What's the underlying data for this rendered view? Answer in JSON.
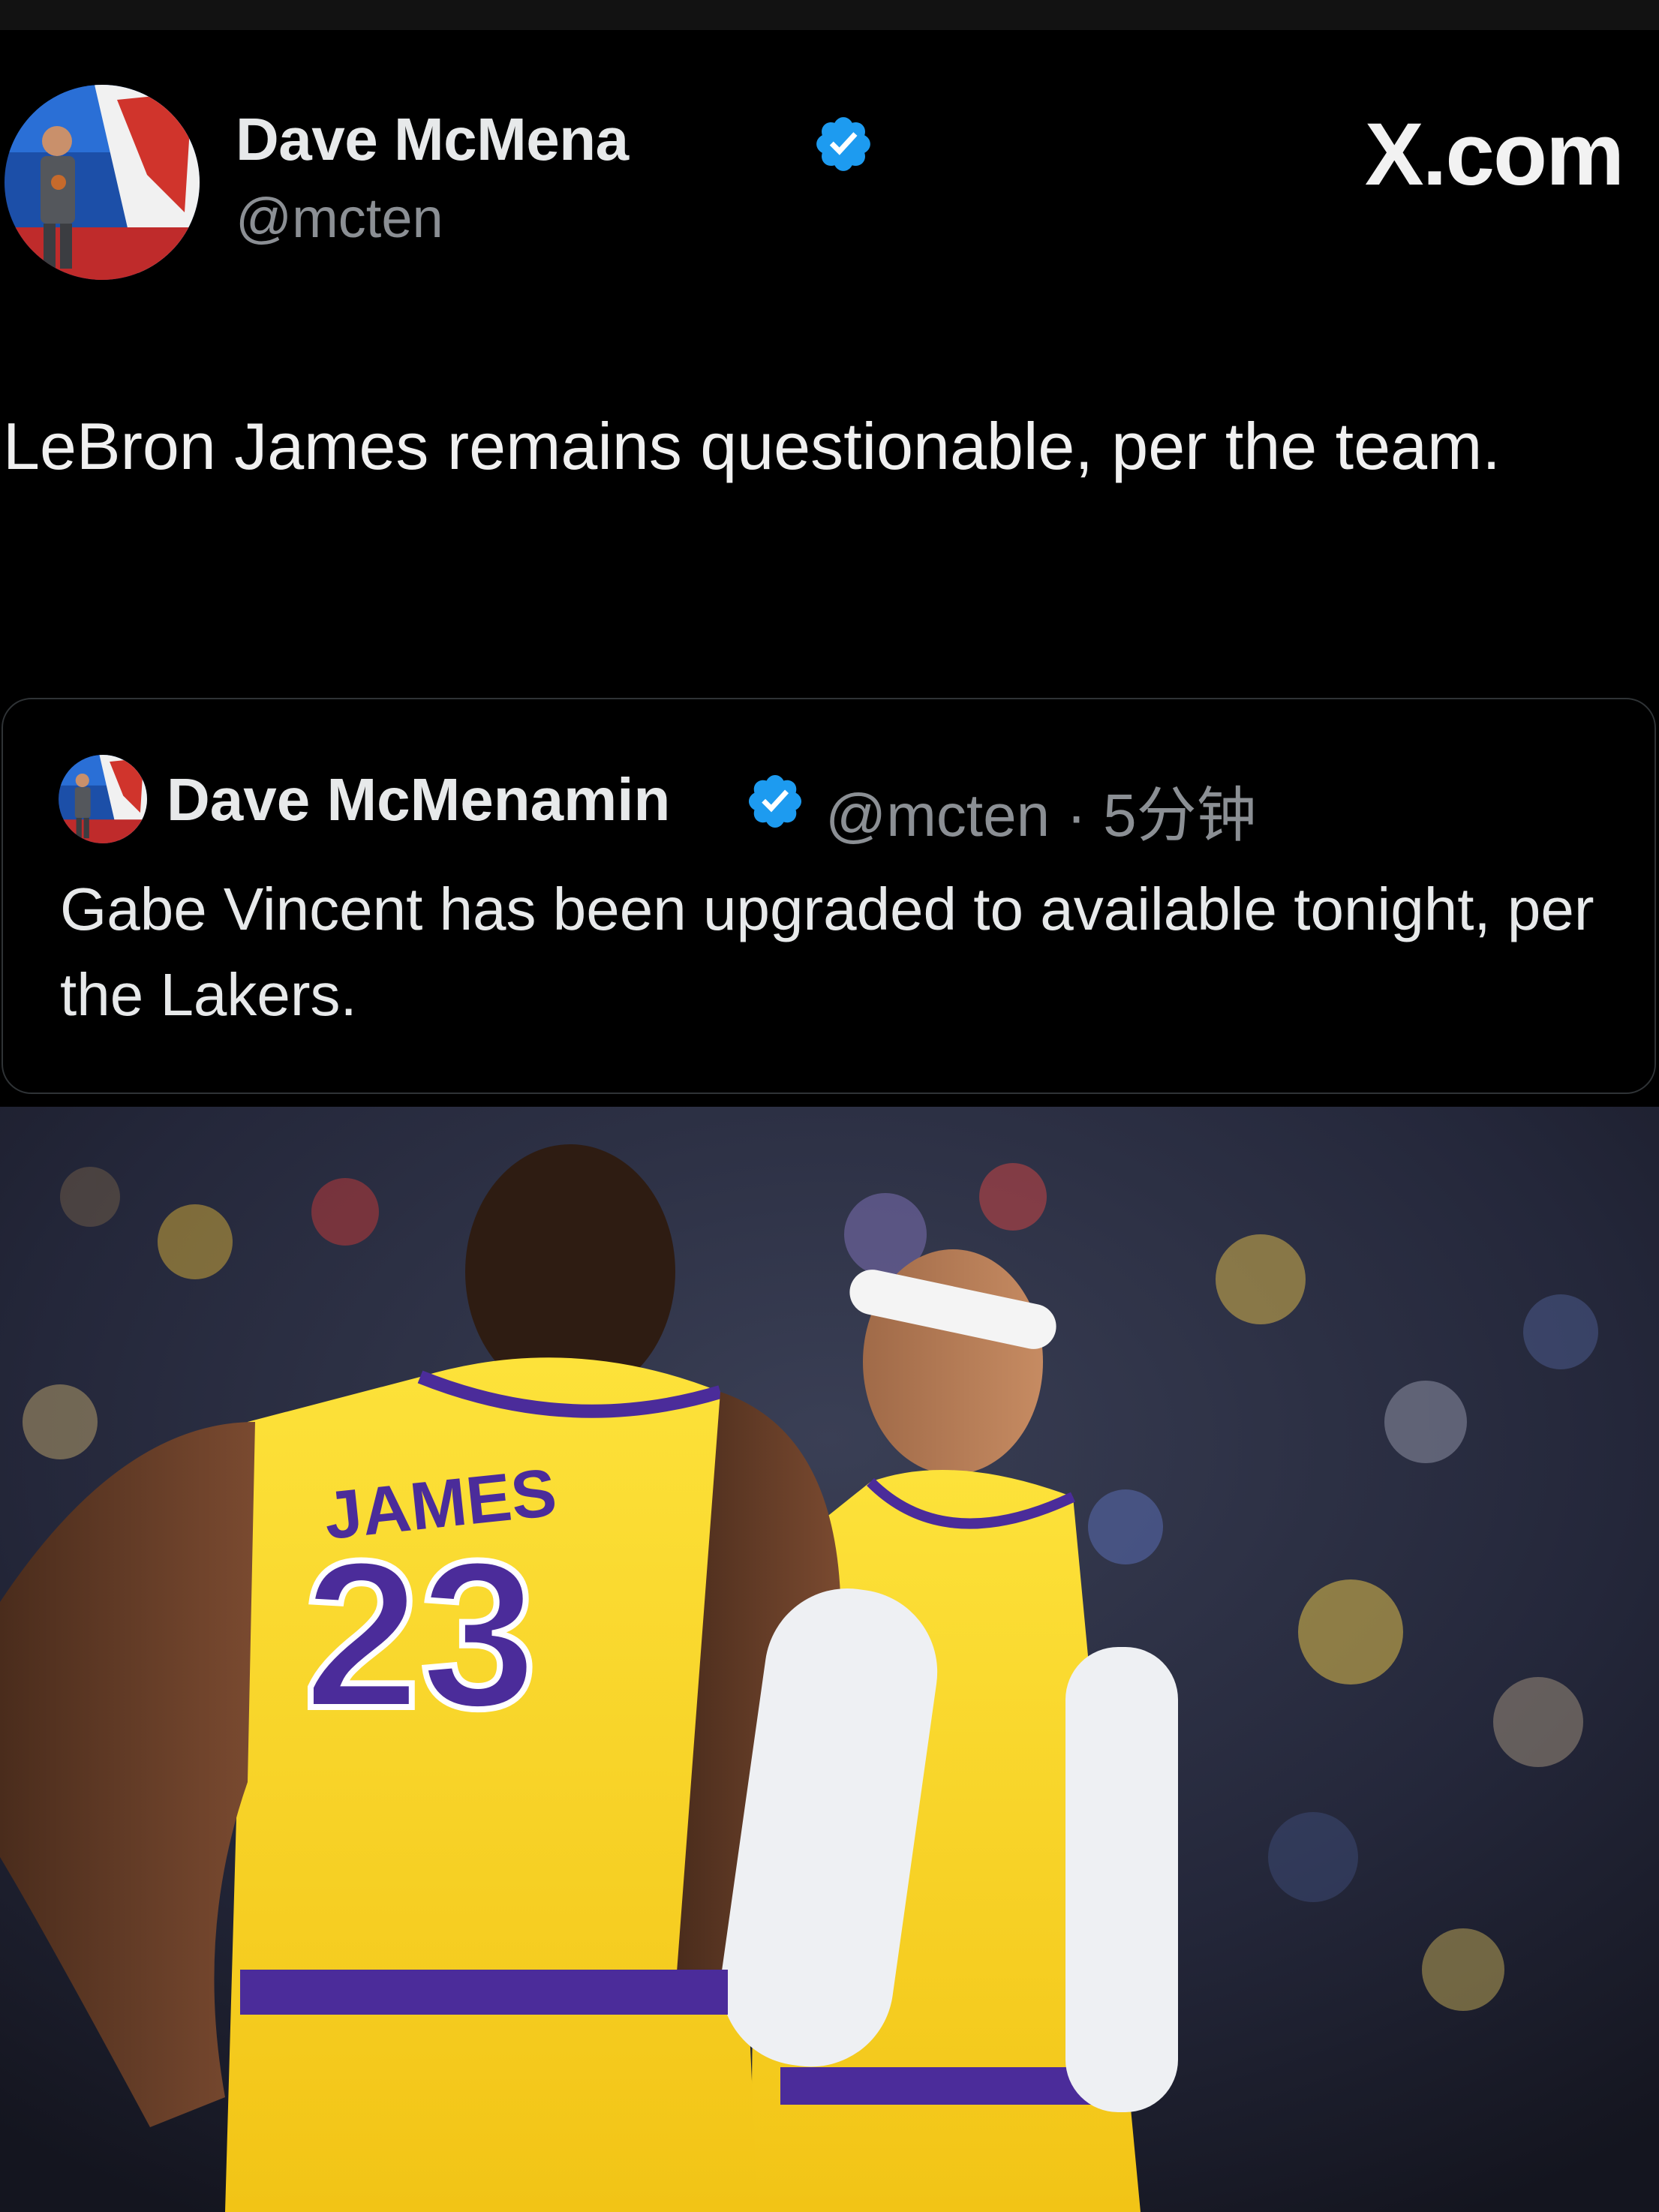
{
  "tweet": {
    "display_name": "Dave McMena",
    "handle": "@mcten",
    "text": "LeBron James remains questionable, per the team."
  },
  "brand": {
    "label": "X.com"
  },
  "quoted_tweet": {
    "display_name": "Dave McMenamin",
    "handle_time": "@mcten · 5分钟",
    "text": "Gabe Vincent has been upgraded to available tonight, per the Lakers."
  },
  "photo": {
    "jersey_name": "JAMES",
    "jersey_number": "23"
  },
  "colors": {
    "background": "#000000",
    "verified": "#1d9bf0",
    "secondary_text": "#8b8f94",
    "lakers_gold": "#fdd82a",
    "lakers_purple": "#4b2c9a"
  },
  "icons": [
    "verified-badge-icon",
    "avatar-image"
  ]
}
